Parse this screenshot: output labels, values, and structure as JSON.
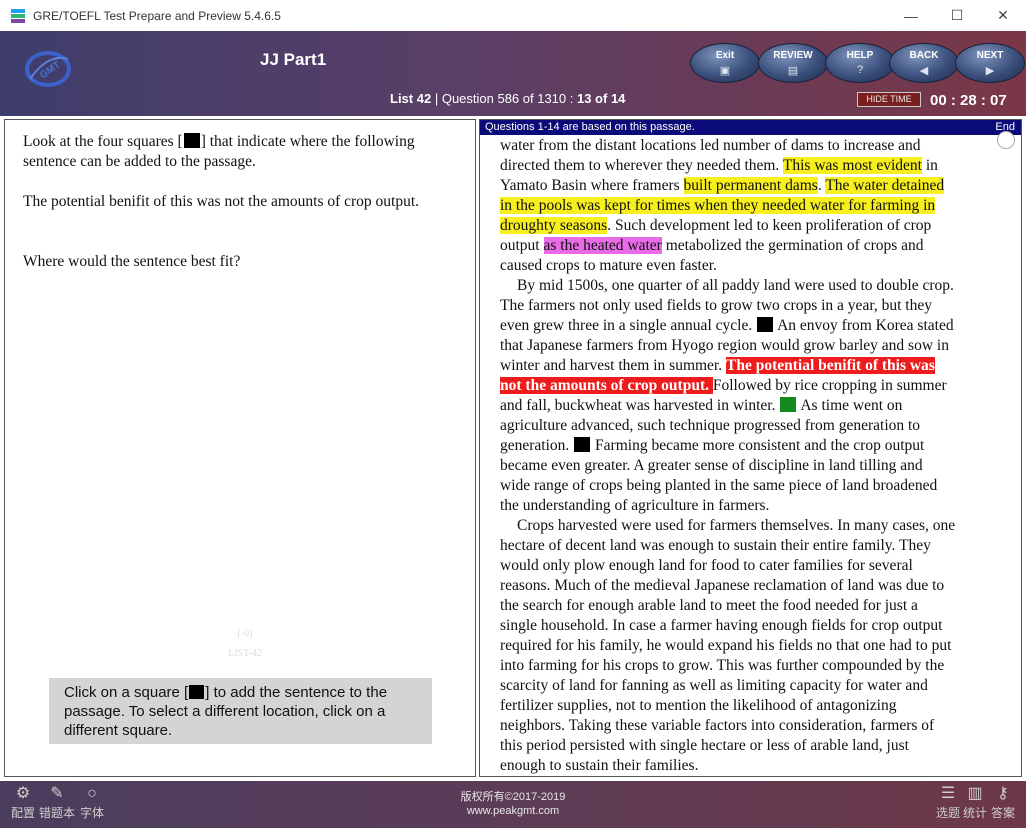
{
  "window": {
    "title": "GRE/TOEFL Test Prepare and Preview 5.4.6.5",
    "controls": {
      "minimize": "—",
      "maximize": "☐",
      "close": "✕"
    }
  },
  "header": {
    "logo_text": "GMT",
    "title": "JJ Part1",
    "list_label": "List 42",
    "separator": "|",
    "question_label": "Question 586 of 1310 : ",
    "question_progress": "13 of 14",
    "hide_time_label": "HIDE TIME",
    "timer": "00 : 28 : 07",
    "buttons": [
      {
        "label": "Exit",
        "icon": "exit-icon"
      },
      {
        "label": "REVIEW",
        "icon": "review-icon"
      },
      {
        "label": "HELP",
        "icon": "help-icon"
      },
      {
        "label": "BACK",
        "icon": "back-arrow-icon"
      },
      {
        "label": "NEXT",
        "icon": "next-arrow-icon"
      }
    ]
  },
  "question": {
    "p1_before": "Look at the four squares [",
    "p1_after": "] that indicate where the following sentence can be added to the passage.",
    "p2": "The potential benifit of this was not the amounts of crop output.",
    "p3": "Where would the sentence best fit?",
    "watermark_1": "[-0]",
    "watermark_2": "LIST-42",
    "instruction_before": "Click on a square [",
    "instruction_after": "] to add the sentence to the passage. To select a different location, click on a different square."
  },
  "passage": {
    "header": "Questions 1-14 are based on this passage.",
    "end_label": "End",
    "l1": "water from the distant locations led number of dams to increase and",
    "l2a": "directed them to wherever they needed them. ",
    "l2b": "This was most evident",
    "l2c": " in",
    "l3a": "Yamato Basin where framers ",
    "l3b": "built permanent dams",
    "l3c": ". ",
    "l3d": "The water detained",
    "l4": "in the pools was kept for times when they needed water for farming in",
    "l5a": "droughty seasons",
    "l5b": ". Such development led to keen proliferation of crop",
    "l6a": "output ",
    "l6b": "as the heated water",
    "l6c": " metabolized the germination of crops and",
    "l7": "caused crops to mature even faster.",
    "l8": "By mid 1500s, one quarter of all paddy land were used to double crop.",
    "l9": "The farmers not only used fields to grow two crops in a year, but they",
    "l10a": "even grew three in a single annual cycle. ",
    "l10b": " An envoy from Korea stated",
    "l11": "that Japanese farmers from Hyogo region would grow barley and sow in",
    "l12a": "winter and harvest them in summer. ",
    "l12b": "The potential benifit of this was",
    "l13a": "not the amounts of crop output. ",
    "l13b": " Followed by rice cropping in summer",
    "l14a": "and fall, buckwheat was harvested in winter. ",
    "l14b": " As time went on",
    "l15": "agriculture advanced, such technique progressed from generation to",
    "l16a": "generation. ",
    "l16b": " Farming became more consistent and the crop output",
    "l17": "became even greater. A greater sense of discipline in land tilling and",
    "l18": "wide range of crops being planted in the same piece of land broadened",
    "l19": "the understanding of agriculture in farmers.",
    "l20": "Crops harvested were used for farmers themselves. In many cases, one",
    "l21": "hectare of decent land was enough to sustain their entire family. They",
    "l22": "would only plow enough land for food to cater families for several",
    "l23": "reasons. Much of the medieval Japanese reclamation of land was due to",
    "l24": "the search for enough arable land to meet the food needed for just a",
    "l25": "single household. In case a farmer having enough fields for crop output",
    "l26": "required for his family, he would expand his fields no that one had to put",
    "l27": "into farming for his crops to grow. This was further compounded by the",
    "l28": "scarcity of land for fanning as well as limiting capacity for water and",
    "l29": "fertilizer supplies, not to mention the likelihood of antagonizing",
    "l30": "neighbors. Taking these variable factors into consideration, farmers of",
    "l31": "this period persisted with single hectare or less of arable land, just",
    "l32": "enough to sustain their families."
  },
  "footer": {
    "left_buttons": [
      {
        "label": "配置",
        "icon": "gear-icon"
      },
      {
        "label": "错题本",
        "icon": "notebook-icon"
      },
      {
        "label": "字体",
        "icon": "font-circle-icon"
      }
    ],
    "right_buttons": [
      {
        "label": "选题",
        "icon": "list-icon"
      },
      {
        "label": "统计",
        "icon": "bar-chart-icon"
      },
      {
        "label": "答案",
        "icon": "key-icon"
      }
    ],
    "copyright_1": "版权所有©2017-2019",
    "copyright_2": "www.peakgmt.com"
  },
  "colors": {
    "highlight_yellow": "#f7ef1e",
    "highlight_pink": "#ea6be8",
    "highlight_red": "#ee1c1c",
    "selected_square": "#138a1e",
    "passage_header_bg": "#0a0a78"
  }
}
